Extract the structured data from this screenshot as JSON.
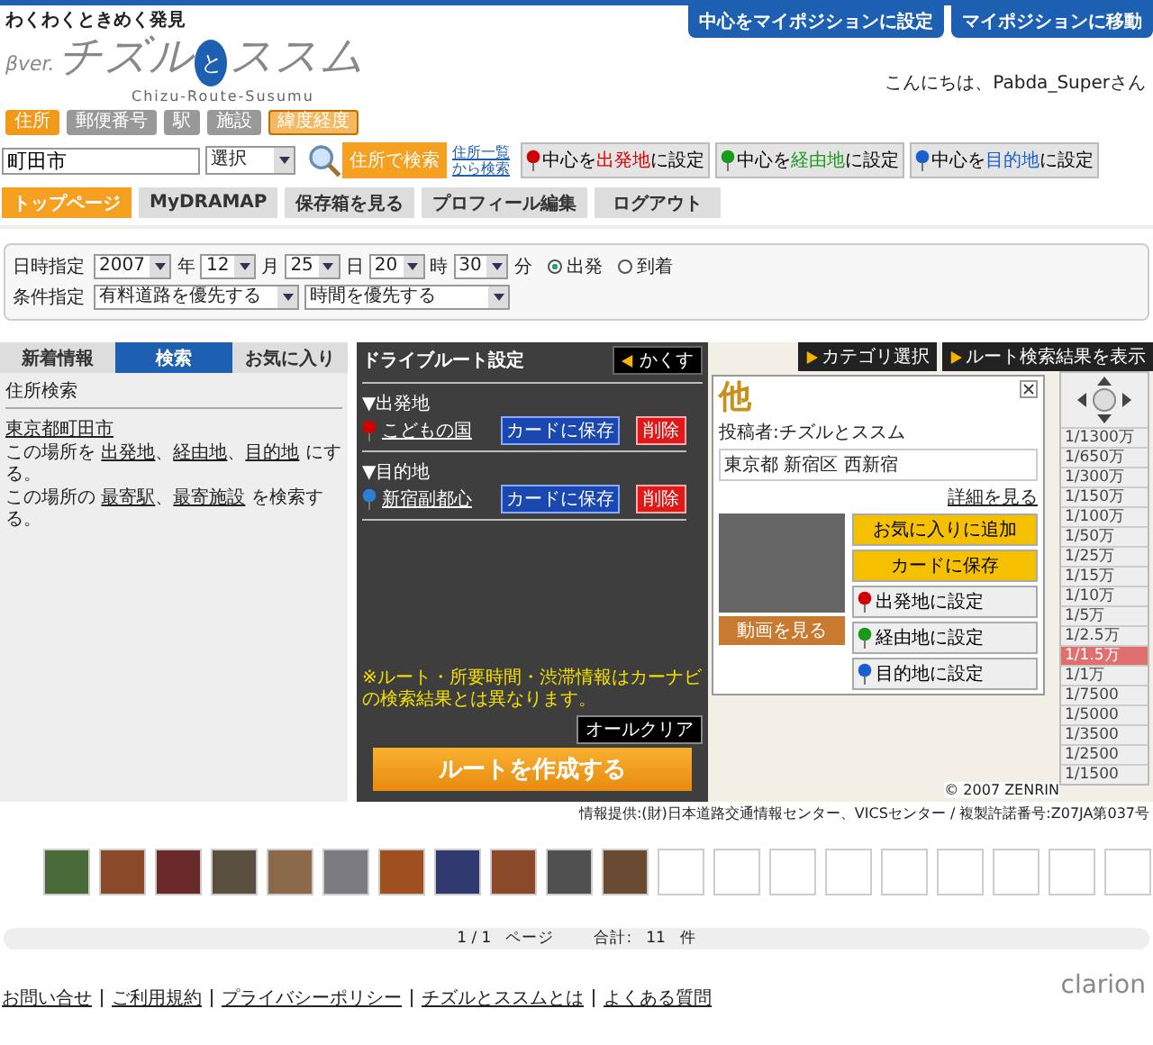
{
  "header": {
    "tagline": "わくわくときめく発見",
    "logo": {
      "version": "βver.",
      "left": "チズル",
      "mid": "と",
      "right": "ススム",
      "roman": "Chizu-Route-Susumu"
    },
    "top_buttons": [
      "中心をマイポジションに設定",
      "マイポジションに移動"
    ],
    "greeting": "こんにちは、Pabda_Superさん"
  },
  "search": {
    "tabs": [
      {
        "label": "住所",
        "selected": true,
        "kind": "plain"
      },
      {
        "label": "郵便番号",
        "selected": false,
        "kind": "plain"
      },
      {
        "label": "駅",
        "selected": false,
        "kind": "plain"
      },
      {
        "label": "施設",
        "selected": false,
        "kind": "plain"
      },
      {
        "label": "緯度経度",
        "selected": false,
        "kind": "accent"
      }
    ],
    "input": {
      "value": "町田市"
    },
    "select": "選択",
    "search_button": "住所で検索",
    "list_link": [
      "住所一覧",
      "から検索"
    ]
  },
  "center_buttons": [
    {
      "pre": "中心を",
      "mark": "出発地",
      "post": "に設定",
      "color": "#d40000"
    },
    {
      "pre": "中心を",
      "mark": "経由地",
      "post": "に設定",
      "color": "#1a9a1a"
    },
    {
      "pre": "中心を",
      "mark": "目的地",
      "post": "に設定",
      "color": "#1a5fd0"
    }
  ],
  "nav": [
    {
      "label": "トップページ",
      "selected": true
    },
    {
      "label": "MyDRAMAP",
      "selected": false
    },
    {
      "label": "保存箱を見る",
      "selected": false
    },
    {
      "label": "プロフィール編集",
      "selected": false
    },
    {
      "label": "ログアウト",
      "selected": false
    }
  ],
  "conditions": {
    "date_label": "日時指定",
    "fields": [
      {
        "value": "2007",
        "unit": "年"
      },
      {
        "value": "12",
        "unit": "月"
      },
      {
        "value": "25",
        "unit": "日"
      },
      {
        "value": "20",
        "unit": "時"
      },
      {
        "value": "30",
        "unit": "分"
      }
    ],
    "modes": [
      {
        "label": "出発",
        "selected": true
      },
      {
        "label": "到着",
        "selected": false
      }
    ],
    "cond_label": "条件指定",
    "options": [
      "有料道路を優先する",
      "時間を優先する"
    ]
  },
  "left_panel": {
    "tabs": [
      {
        "label": "新着情報",
        "selected": false
      },
      {
        "label": "検索",
        "selected": true
      },
      {
        "label": "お気に入り",
        "selected": false
      }
    ],
    "heading": "住所検索",
    "place": "東京都町田市",
    "lines": [
      {
        "lead": "この場所を",
        "links": [
          {
            "text": "出発地",
            "sep": "、"
          },
          {
            "text": "経由地",
            "sep": "、"
          },
          {
            "text": "目的地"
          }
        ],
        "tail": "にする。"
      },
      {
        "lead": "この場所の",
        "links": [
          {
            "text": "最寄駅",
            "sep": "、"
          },
          {
            "text": "最寄施設"
          }
        ],
        "tail": "を検索する。"
      }
    ]
  },
  "map": {
    "toolbar": [
      "カテゴリ選択",
      "ルート検索結果を表示"
    ],
    "scales": [
      {
        "label": "1/1300万",
        "selected": false
      },
      {
        "label": "1/650万",
        "selected": false
      },
      {
        "label": "1/300万",
        "selected": false
      },
      {
        "label": "1/150万",
        "selected": false
      },
      {
        "label": "1/100万",
        "selected": false
      },
      {
        "label": "1/50万",
        "selected": false
      },
      {
        "label": "1/25万",
        "selected": false
      },
      {
        "label": "1/15万",
        "selected": false
      },
      {
        "label": "1/10万",
        "selected": false
      },
      {
        "label": "1/5万",
        "selected": false
      },
      {
        "label": "1/2.5万",
        "selected": false
      },
      {
        "label": "1/1.5万",
        "selected": true
      },
      {
        "label": "1/1万",
        "selected": false
      },
      {
        "label": "1/7500",
        "selected": false
      },
      {
        "label": "1/5000",
        "selected": false
      },
      {
        "label": "1/3500",
        "selected": false
      },
      {
        "label": "1/2500",
        "selected": false
      },
      {
        "label": "1/1500",
        "selected": false
      }
    ],
    "copyright": "© 2007 ZENRIN"
  },
  "popup": {
    "title": "他",
    "author": "投稿者:チズルとススム",
    "address": "東京都 新宿区 西新宿",
    "detail_link": "詳細を見る",
    "video_button": "動画を見る",
    "actions": [
      {
        "label": "お気に入りに追加",
        "kind": "plain"
      },
      {
        "label": "カードに保存",
        "kind": "plain"
      },
      {
        "label": "出発地に設定",
        "kind": "pin",
        "color": "#d40000"
      },
      {
        "label": "経由地に設定",
        "kind": "pin",
        "color": "#1a9a1a"
      },
      {
        "label": "目的地に設定",
        "kind": "pin",
        "color": "#1a5fd0"
      }
    ]
  },
  "drive_panel": {
    "title": "ドライブルート設定",
    "hide_button": "かくす",
    "points": [
      {
        "heading": "▼出発地",
        "place": "こどもの国",
        "color": "#d40000",
        "save": "カードに保存",
        "delete": "削除"
      },
      {
        "heading": "▼目的地",
        "place": "新宿副都心",
        "color": "#2a7fd8",
        "save": "カードに保存",
        "delete": "削除"
      }
    ],
    "note": "※ルート・所要時間・渋滞情報はカーナビの検索結果とは異なります。",
    "clear_button": "オールクリア",
    "create_button": "ルートを作成する"
  },
  "credit": "情報提供:(財)日本道路交通情報センター、VICSセンター / 複製許諾番号:Z07JA第037号",
  "thumbnails": [
    {
      "filled": true
    },
    {
      "filled": true
    },
    {
      "filled": true
    },
    {
      "filled": true
    },
    {
      "filled": true
    },
    {
      "filled": true
    },
    {
      "filled": true
    },
    {
      "filled": true
    },
    {
      "filled": true
    },
    {
      "filled": true
    },
    {
      "filled": true
    },
    {
      "filled": false
    },
    {
      "filled": false
    },
    {
      "filled": false
    },
    {
      "filled": false
    },
    {
      "filled": false
    },
    {
      "filled": false
    },
    {
      "filled": false
    },
    {
      "filled": false
    },
    {
      "filled": false
    }
  ],
  "pager": {
    "page": "1 / 1",
    "page_label": "ページ",
    "total_label": "合計:",
    "total": "11",
    "unit": "件"
  },
  "footer": {
    "links": [
      "お問い合せ",
      "ご利用規約",
      "プライバシーポリシー",
      "チズルとススムとは",
      "よくある質問"
    ],
    "brand": "clarion"
  }
}
